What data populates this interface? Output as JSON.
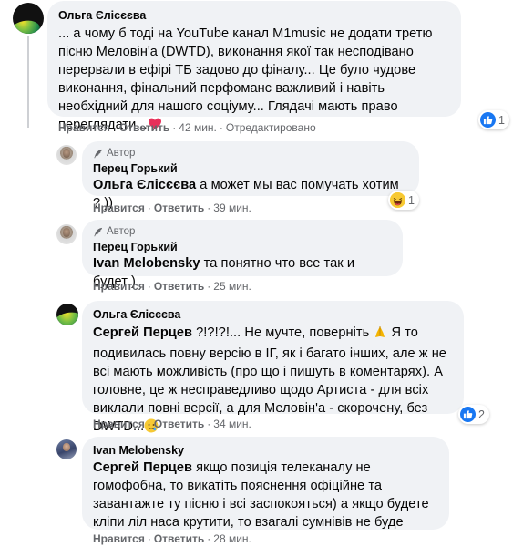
{
  "comments": [
    {
      "author": "Ольга Єлісєєва",
      "text_parts": [
        "... а чому б тоді на YouTube канал M1music не додати третю пісню Меловін'а (DWTD), виконання якої так несподівано перервали в ефірі ТБ задово до фіналу... Це було чудове виконання, фінальний перфоманс важливий і навіть необхідний для нашого соціуму... Глядачі мають право переглядати..."
      ],
      "trailing_emoji": "heart-emoji",
      "actions": {
        "like": "Нравится",
        "reply": "Ответить",
        "time": "42 мин.",
        "edited": "Отредактировано"
      },
      "reaction": {
        "icon": "like-icon",
        "count": "1"
      }
    },
    {
      "author_badge": "Автор",
      "author": "Перец Горький",
      "mention": "Ольга Єлісєєва",
      "text": " а может мы вас помучать хотим ? ))",
      "actions": {
        "like": "Нравится",
        "reply": "Ответить",
        "time": "39 мин."
      },
      "reaction": {
        "icon": "haha-icon",
        "count": "1"
      }
    },
    {
      "author_badge": "Автор",
      "author": "Перец Горький",
      "mention": "Ivan Melobensky",
      "text": " та понятно что все так и будет )",
      "actions": {
        "like": "Нравится",
        "reply": "Ответить",
        "time": "25 мин."
      }
    },
    {
      "author": "Ольга Єлісєєва",
      "mention": "Сергей Перцев",
      "text_a": " ?!?!?!... Не мучте, поверніть ",
      "text_b": " Я то подивилась повну версію в ІГ, як і багато інших, але ж не всі мають можливість (про що і пишуть в коментарях). А головне, це ж несправедливо щодо Артиста - для всіх виклали повні версії, а для Меловін'а - скорочену, без DWTD...",
      "emoji_a": "pray-emoji",
      "emoji_b": "sad-emoji",
      "actions": {
        "like": "Нравится",
        "reply": "Ответить",
        "time": "34 мин."
      },
      "reaction": {
        "icon": "like-icon",
        "count": "2"
      }
    },
    {
      "author": "Ivan Melobensky",
      "mention": "Сергей Перцев",
      "text": " якщо позиція телеканалу не гомофобна, то викатіть пояснення офіційне та завантажте ту пісню і всі заспокояться) а якщо будете кліпи ліл наса крутити, то взагалі сумнівів не буде",
      "actions": {
        "like": "Нравится",
        "reply": "Ответить",
        "time": "28 мин."
      }
    }
  ],
  "dot": "·",
  "colors": {
    "bubble": "#f0f2f5",
    "like_blue": "#1877f2",
    "meta_gray": "#65676b"
  }
}
